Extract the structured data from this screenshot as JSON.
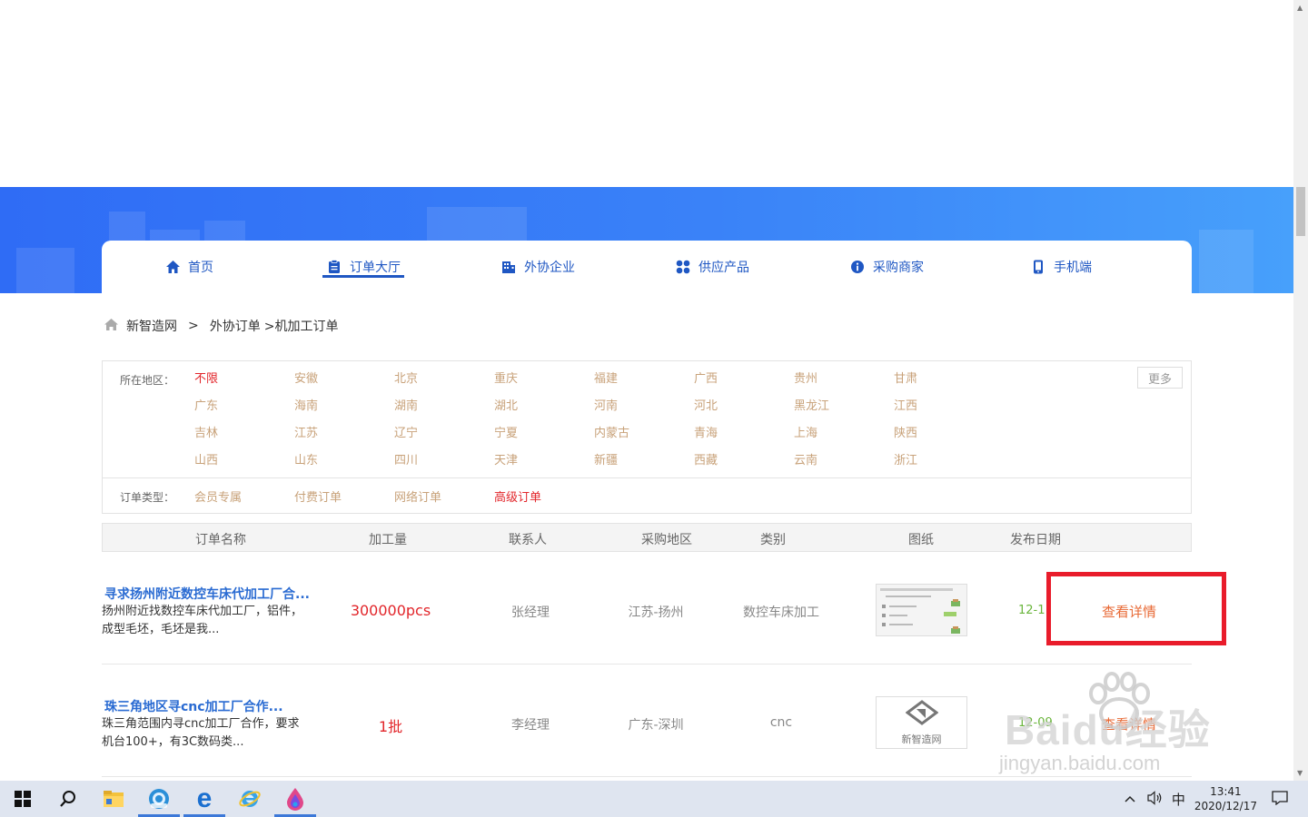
{
  "nav": {
    "items": [
      {
        "label": "首页"
      },
      {
        "label": "订单大厅"
      },
      {
        "label": "外协企业"
      },
      {
        "label": "供应产品"
      },
      {
        "label": "采购商家"
      },
      {
        "label": "手机端"
      }
    ],
    "active_index": 1,
    "colors": {
      "accent": "#1f57c3",
      "banner": "#2f6cf5"
    }
  },
  "breadcrumb": {
    "home": "新智造网",
    "separator": ">",
    "level1": "外协订单",
    "level2": ">机加工订单"
  },
  "filter": {
    "region_label": "所在地区：",
    "regions": [
      "不限",
      "安徽",
      "北京",
      "重庆",
      "福建",
      "广西",
      "贵州",
      "甘肃",
      "广东",
      "海南",
      "湖南",
      "湖北",
      "河南",
      "河北",
      "黑龙江",
      "江西",
      "吉林",
      "江苏",
      "辽宁",
      "宁夏",
      "内蒙古",
      "青海",
      "上海",
      "陕西",
      "山西",
      "山东",
      "四川",
      "天津",
      "新疆",
      "西藏",
      "云南",
      "浙江"
    ],
    "selected_region": "不限",
    "more_label": "更多",
    "type_label": "订单类型：",
    "types": [
      "会员专属",
      "付费订单",
      "网络订单",
      "高级订单"
    ],
    "selected_type": "高级订单"
  },
  "table": {
    "headers": [
      "订单名称",
      "加工量",
      "联系人",
      "采购地区",
      "类别",
      "图纸",
      "发布日期"
    ],
    "rows": [
      {
        "title": "寻求扬州附近数控车床代加工厂合...",
        "desc": "扬州附近找数控车床代加工厂，铝件，成型毛坯，毛坯是我...",
        "qty": "300000pcs",
        "contact": "张经理",
        "region": "江苏-扬州",
        "category": "数控车床加工",
        "date": "12-1",
        "detail": "查看详情"
      },
      {
        "title": "珠三角地区寻cnc加工厂合作...",
        "desc": "珠三角范围内寻cnc加工厂合作，要求机台100+，有3C数码类...",
        "qty": "1批",
        "contact": "李经理",
        "region": "广东-深圳",
        "category": "cnc",
        "date": "12-09",
        "detail": "查看详情",
        "thumb_label": "新智造网"
      }
    ]
  },
  "taskbar": {
    "time": "13:41",
    "date": "2020/12/17",
    "ime": "中"
  },
  "watermark": {
    "brand": "Baidu经验",
    "url": "jingyan.baidu.com"
  }
}
